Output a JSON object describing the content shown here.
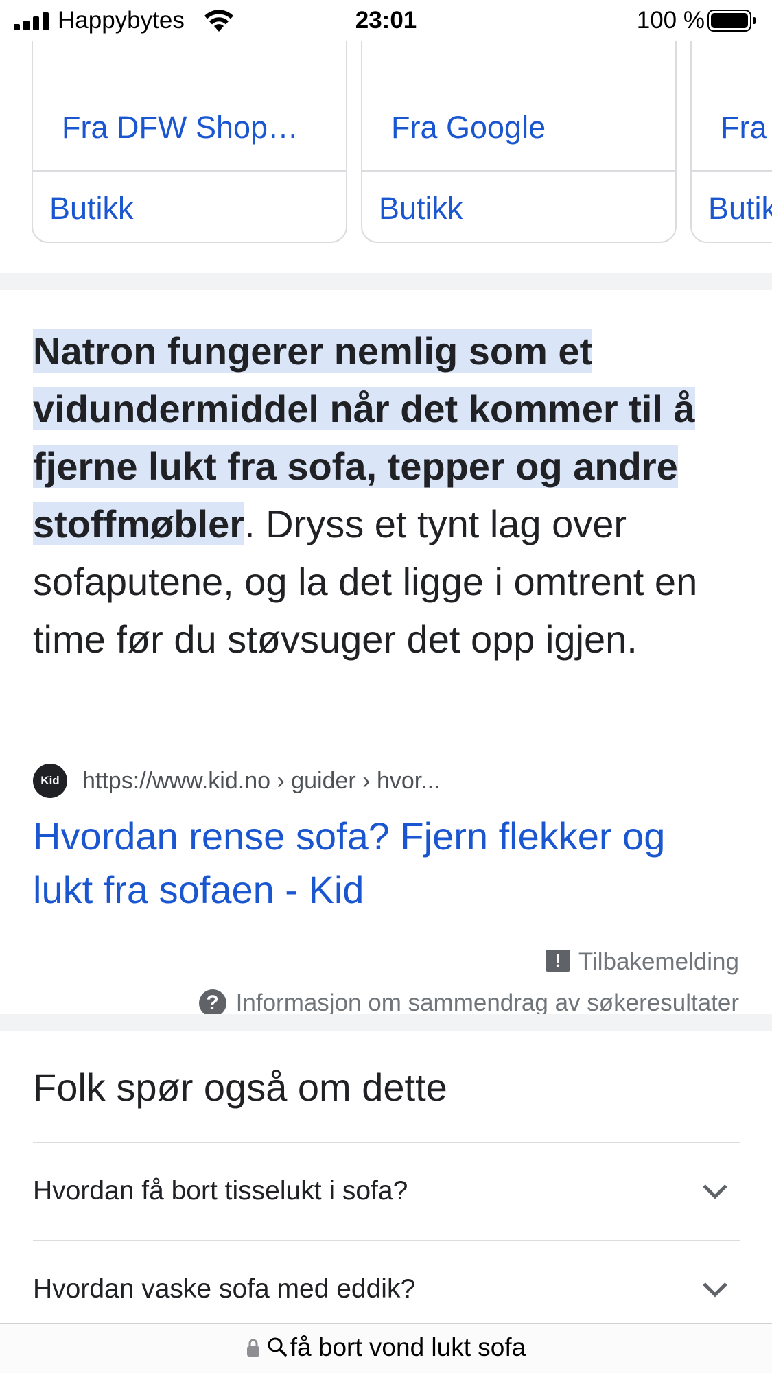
{
  "status_bar": {
    "carrier": "Happybytes",
    "time": "23:01",
    "battery_percent": "100 %"
  },
  "cards": [
    {
      "source": "Fra DFW Shop…",
      "action": "Butikk"
    },
    {
      "source": "Fra Google",
      "action": "Butikk"
    },
    {
      "source": "Fra",
      "action": "Butikk"
    }
  ],
  "snippet": {
    "highlighted": "Natron fungerer nemlig som et vidundermiddel når det kommer til å fjerne lukt fra sofa, tepper og andre stoffmøbler",
    "rest": ". Dryss et tynt lag over sofaputene, og la det ligge i omtrent en time før du støvsuger det opp igjen."
  },
  "source": {
    "favicon_text": "Kid",
    "url": "https://www.kid.no › guider › hvor...",
    "title": "Hvordan rense sofa? Fjern flekker og lukt fra sofaen - Kid"
  },
  "feedback": {
    "feedback_icon": "!",
    "label": "Tilbakemelding",
    "about_icon": "?",
    "about_label": "Informasjon om sammendrag av søkeresultater"
  },
  "people_also_ask": {
    "title": "Folk spør også om dette",
    "questions": [
      "Hvordan få bort tisselukt i sofa?",
      "Hvordan vaske sofa med eddik?"
    ]
  },
  "url_bar": {
    "query": "få bort vond lukt sofa"
  },
  "colors": {
    "link": "#1a56cf",
    "highlight": "#dbe5f8",
    "divider": "#dadce0"
  }
}
